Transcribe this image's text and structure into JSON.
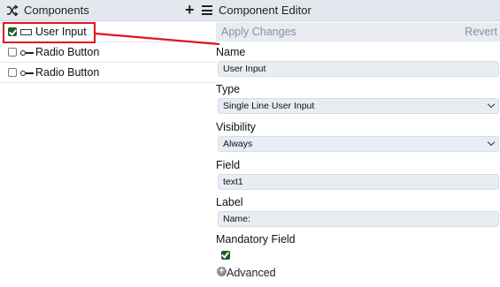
{
  "left_panel": {
    "title": "Components",
    "add_icon": "plus-icon",
    "menu_icon": "hamburger-menu-icon",
    "items": [
      {
        "label": "User Input",
        "checked": true,
        "icon": "text-input-icon"
      },
      {
        "label": "Radio Button",
        "checked": false,
        "icon": "radio-button-icon"
      },
      {
        "label": "Radio Button",
        "checked": false,
        "icon": "radio-button-icon"
      }
    ]
  },
  "right_panel": {
    "title": "Component Editor",
    "toolbar": {
      "apply_label": "Apply Changes",
      "revert_label": "Revert"
    },
    "name": {
      "label": "Name",
      "value": "User Input"
    },
    "type": {
      "label": "Type",
      "value": "Single Line User Input"
    },
    "visibility": {
      "label": "Visibility",
      "value": "Always"
    },
    "field": {
      "label": "Field",
      "value": "text1"
    },
    "label": {
      "label": "Label",
      "value": "Name:"
    },
    "mandatory": {
      "label": "Mandatory Field",
      "checked": true
    },
    "advanced": {
      "label": "Advanced",
      "icon": "plus-circle-icon"
    }
  },
  "colors": {
    "header_bg": "#e4e8ee",
    "highlight": "#e0151d",
    "checkbox_on": "#1e5f2a",
    "field_bg": "#e8edf3"
  }
}
